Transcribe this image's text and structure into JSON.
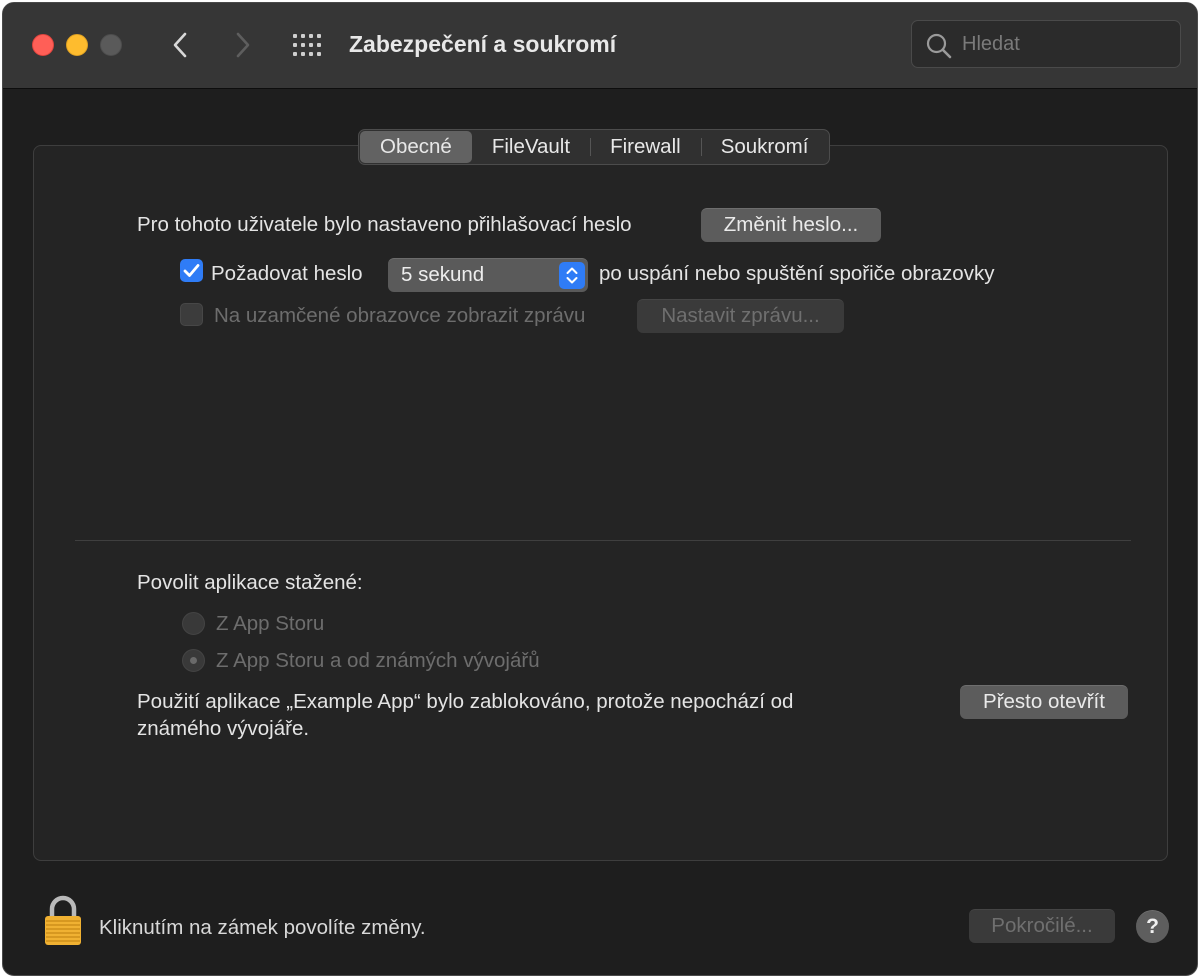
{
  "window": {
    "title": "Zabezpečení a soukromí",
    "search_placeholder": "Hledat"
  },
  "tabs": [
    {
      "label": "Obecné",
      "active": true
    },
    {
      "label": "FileVault",
      "active": false
    },
    {
      "label": "Firewall",
      "active": false
    },
    {
      "label": "Soukromí",
      "active": false
    }
  ],
  "general": {
    "password_text": "Pro tohoto uživatele bylo nastaveno přihlašovací heslo",
    "change_password_button": "Změnit heslo...",
    "require_password": {
      "checked": true,
      "label": "Požadovat heslo",
      "delay_value": "5 sekund",
      "suffix": "po uspání nebo spuštění spořiče obrazovky"
    },
    "lock_message": {
      "checked": false,
      "enabled": false,
      "label": "Na uzamčené obrazovce zobrazit zprávu",
      "button": "Nastavit zprávu..."
    }
  },
  "downloads": {
    "heading": "Povolit aplikace stažené:",
    "options": [
      {
        "label": "Z App Storu",
        "selected": false,
        "enabled": false
      },
      {
        "label": "Z App Storu a od známých vývojářů",
        "selected": true,
        "enabled": false
      }
    ],
    "blocked_text_line1": "Použití aplikace „Example App“ bylo zablokováno, protože nepochází od",
    "blocked_text_line2": "známého vývojáře.",
    "open_anyway_button": "Přesto otevřít"
  },
  "footer": {
    "lock_text": "Kliknutím na zámek povolíte změny.",
    "advanced_button": "Pokročilé...",
    "help_label": "?"
  },
  "colors": {
    "accent": "#2f7cf6",
    "close": "#ff5f57",
    "minimize": "#febc2e",
    "lock": "#f0b132"
  }
}
